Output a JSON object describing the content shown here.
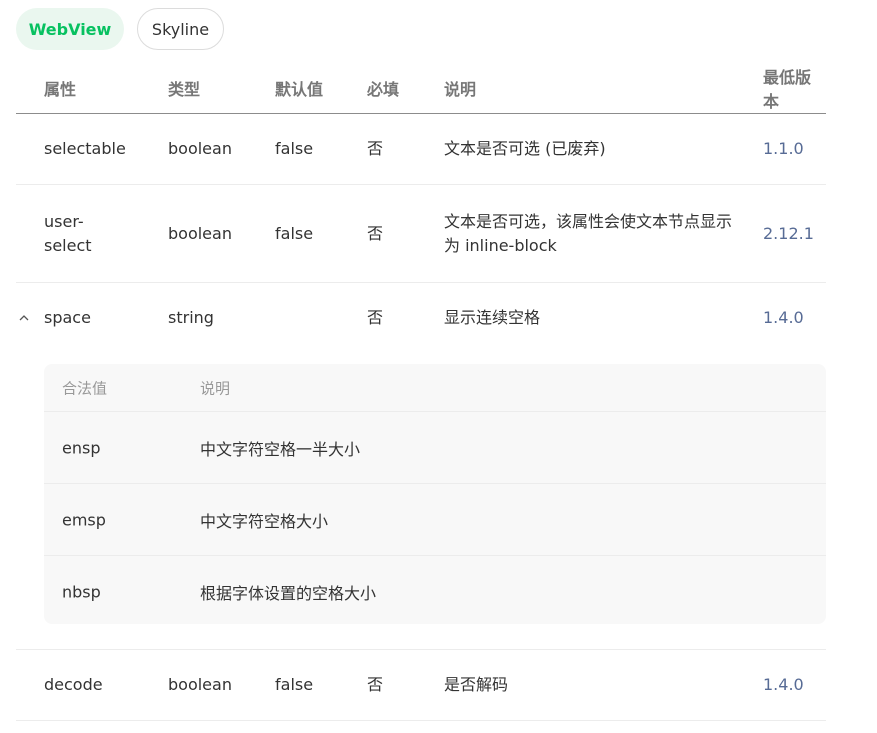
{
  "tabs": [
    {
      "label": "WebView",
      "active": true
    },
    {
      "label": "Skyline",
      "active": false
    }
  ],
  "colors": {
    "accent": "#07c160",
    "version": "#576b95"
  },
  "table": {
    "headers": {
      "name": "属性",
      "type": "类型",
      "default": "默认值",
      "required": "必填",
      "desc": "说明",
      "version": "最低版本"
    },
    "rows": [
      {
        "name": "selectable",
        "type": "boolean",
        "default": "false",
        "required": "否",
        "desc": "文本是否可选 (已废弃)",
        "version": "1.1.0"
      },
      {
        "name": "user-select",
        "type": "boolean",
        "default": "false",
        "required": "否",
        "desc": "文本是否可选，该属性会使文本节点显示为 inline-block",
        "version": "2.12.1"
      },
      {
        "name": "space",
        "type": "string",
        "default": "",
        "required": "否",
        "desc": "显示连续空格",
        "version": "1.4.0",
        "expanded": true,
        "toggle_icon": "chevron-up-icon"
      },
      {
        "name": "decode",
        "type": "boolean",
        "default": "false",
        "required": "否",
        "desc": "是否解码",
        "version": "1.4.0"
      }
    ]
  },
  "space_values": {
    "headers": {
      "value": "合法值",
      "desc": "说明"
    },
    "rows": [
      {
        "value": "ensp",
        "desc": "中文字符空格一半大小"
      },
      {
        "value": "emsp",
        "desc": "中文字符空格大小"
      },
      {
        "value": "nbsp",
        "desc": "根据字体设置的空格大小"
      }
    ]
  }
}
